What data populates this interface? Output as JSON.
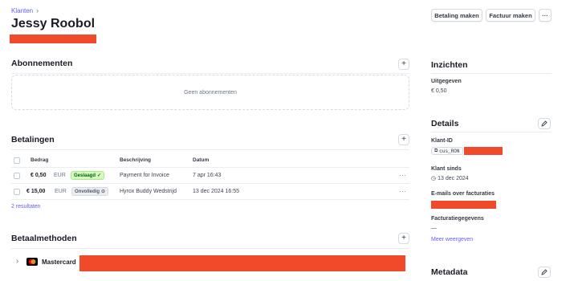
{
  "breadcrumb": {
    "parent": "Klanten",
    "sep": "›"
  },
  "customer": {
    "name": "Jessy Roobol"
  },
  "header_actions": {
    "payment": "Betaling maken",
    "invoice": "Factuur maken",
    "more": "···"
  },
  "subscriptions": {
    "title": "Abonnementen",
    "empty": "Geen abonnementen",
    "add": "+"
  },
  "payments": {
    "title": "Betalingen",
    "add": "+",
    "columns": {
      "amount": "Bedrag",
      "description": "Beschrijving",
      "date": "Datum"
    },
    "rows": [
      {
        "amount": "€ 0,50",
        "currency": "EUR",
        "status": "Geslaagd",
        "status_icon": "✓",
        "description": "Payment for Invoice",
        "date": "7 apr 16:43",
        "more": "···"
      },
      {
        "amount": "€ 15,00",
        "currency": "EUR",
        "status": "Onvolledig",
        "status_icon": "⊙",
        "description": "Hyrox Buddy Wedstrijd",
        "date": "13 dec 2024 16:55",
        "more": "···"
      }
    ],
    "results": "2 resultaten"
  },
  "payment_methods": {
    "title": "Betaalmethoden",
    "add": "+",
    "card_brand": "Mastercard",
    "chevron": "›"
  },
  "insights": {
    "title": "Inzichten",
    "spent_label": "Uitgegeven",
    "spent_value": "€ 0,50"
  },
  "details": {
    "title": "Details",
    "id_label": "Klant-ID",
    "id_value": "cus_RON",
    "since_label": "Klant sinds",
    "since_value": "13 dec 2024",
    "emails_label": "E-mails over facturaties",
    "billing_label": "Facturatiegegevens",
    "billing_value": "—",
    "more_link": "Meer weergeven"
  },
  "metadata": {
    "title": "Metadata"
  },
  "colors": {
    "accent": "#635bff",
    "redaction": "#f14a2a",
    "success": "#006908"
  }
}
